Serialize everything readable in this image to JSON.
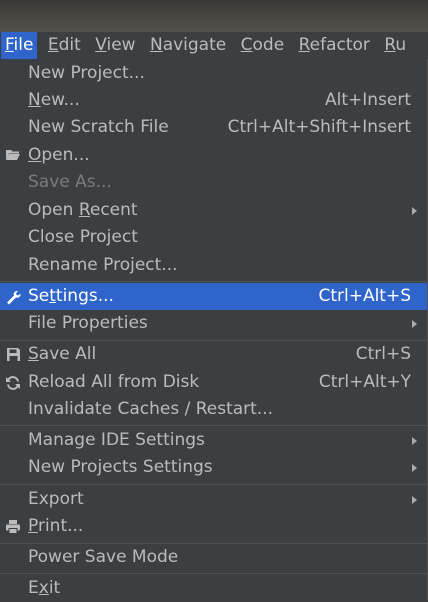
{
  "menubar": {
    "items": [
      {
        "pre": "",
        "u": "F",
        "post": "ile"
      },
      {
        "pre": "",
        "u": "E",
        "post": "dit"
      },
      {
        "pre": "",
        "u": "V",
        "post": "iew"
      },
      {
        "pre": "",
        "u": "N",
        "post": "avigate"
      },
      {
        "pre": "",
        "u": "C",
        "post": "ode"
      },
      {
        "pre": "",
        "u": "R",
        "post": "efactor"
      },
      {
        "pre": "",
        "u": "R",
        "post": "u"
      }
    ]
  },
  "menu": {
    "new_project": "New Project...",
    "new": {
      "pre": "",
      "u": "N",
      "post": "ew...",
      "shortcut": "Alt+Insert"
    },
    "new_scratch": {
      "label": "New Scratch File",
      "shortcut": "Ctrl+Alt+Shift+Insert"
    },
    "open": {
      "pre": "",
      "u": "O",
      "post": "pen..."
    },
    "save_as": "Save As...",
    "open_recent": {
      "pre": "Open ",
      "u": "R",
      "post": "ecent"
    },
    "close_project": "Close Project",
    "rename_project": "Rename Project...",
    "settings": {
      "pre": "Se",
      "u": "t",
      "post": "tings...",
      "shortcut": "Ctrl+Alt+S"
    },
    "file_properties": "File Properties",
    "save_all": {
      "pre": "",
      "u": "S",
      "post": "ave All",
      "shortcut": "Ctrl+S"
    },
    "reload": {
      "label": "Reload All from Disk",
      "shortcut": "Ctrl+Alt+Y"
    },
    "invalidate": "Invalidate Caches / Restart...",
    "manage_ide": "Manage IDE Settings",
    "new_projects_settings": "New Projects Settings",
    "export": "Export",
    "print": {
      "pre": "",
      "u": "P",
      "post": "rint..."
    },
    "power_save": "Power Save Mode",
    "exit": {
      "pre": "E",
      "u": "x",
      "post": "it"
    }
  },
  "colors": {
    "background": "#3c3f41",
    "selection": "#2f65ca",
    "text": "#bbbbbb",
    "disabled": "#7b7b7b",
    "separator": "#515151"
  },
  "icons": {
    "open": "folder-open-icon",
    "settings": "wrench-icon",
    "save_all": "floppy-disk-icon",
    "reload": "refresh-icon",
    "print": "printer-icon"
  }
}
